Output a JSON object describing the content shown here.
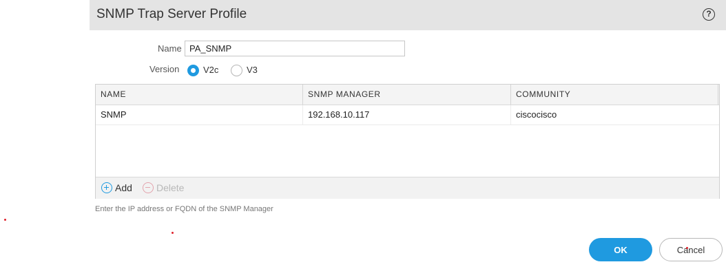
{
  "dialog": {
    "title": "SNMP Trap Server Profile",
    "help_icon": "help-circle-icon",
    "help_glyph": "?"
  },
  "form": {
    "name_label": "Name",
    "name_value": "PA_SNMP",
    "version_label": "Version",
    "version_options": [
      {
        "label": "V2c",
        "selected": true
      },
      {
        "label": "V3",
        "selected": false
      }
    ]
  },
  "table": {
    "columns": [
      "NAME",
      "SNMP MANAGER",
      "COMMUNITY"
    ],
    "rows": [
      {
        "name": "SNMP",
        "manager": "192.168.10.117",
        "community": "ciscocisco"
      }
    ],
    "add_label": "Add",
    "delete_label": "Delete",
    "add_icon": "plus-circle-icon",
    "delete_icon": "minus-circle-icon"
  },
  "help_text": "Enter the IP address or FQDN of the SNMP Manager",
  "buttons": {
    "ok_label": "OK",
    "cancel_label": "Cancel"
  },
  "colors": {
    "accent": "#1f9ae0",
    "header_bg": "#e4e4e4",
    "marker_red": "#e0202a"
  }
}
